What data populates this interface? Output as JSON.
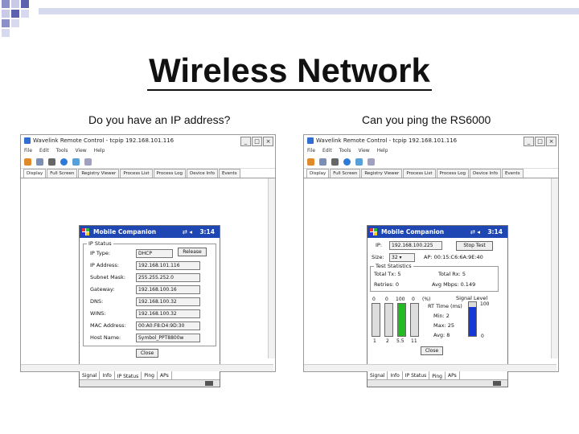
{
  "slide": {
    "title": "Wireless Network",
    "left_caption": "Do you have an IP address?",
    "right_caption": "Can you ping the RS6000"
  },
  "window_common": {
    "title": "Wavelink Remote Control - tcpip 192.168.101.116",
    "menu": [
      "File",
      "Edit",
      "Tools",
      "View",
      "Help"
    ],
    "tabs": [
      "Display",
      "Full Screen",
      "Registry Viewer",
      "Process List",
      "Process Log",
      "Device Info",
      "Events"
    ],
    "selected_tab": "Display",
    "app_name": "Mobile Companion",
    "signal_symbol": "⇄ ◂",
    "time": "3:14",
    "bottom_tabs": [
      "Signal",
      "Info",
      "IP Status",
      "Ping",
      "APs"
    ]
  },
  "left_device": {
    "selected_bottom_tab": "IP Status",
    "group_title": "IP Status",
    "release_button": "Release",
    "fields": [
      {
        "label": "IP Type:",
        "value": "DHCP"
      },
      {
        "label": "IP Address:",
        "value": "192.168.101.116"
      },
      {
        "label": "Subnet Mask:",
        "value": "255.255.252.0"
      },
      {
        "label": "Gateway:",
        "value": "192.168.100.16"
      },
      {
        "label": "DNS:",
        "value": "192.168.100.32"
      },
      {
        "label": "WINS:",
        "value": "192.168.100.32"
      },
      {
        "label": "MAC Address:",
        "value": "00:A0:F8:D4:9D:30"
      },
      {
        "label": "Host Name:",
        "value": "Symbol_PPT8800w"
      }
    ],
    "close_button": "Close"
  },
  "right_device": {
    "selected_bottom_tab": "Ping",
    "ip_label": "IP:",
    "ip_value": "192.168.100.225",
    "stop_button": "Stop Test",
    "size_label": "Size:",
    "size_value": "32",
    "ap_text": "AP: 00:15:C6:6A:9E:40",
    "stats_title": "Test Statistics",
    "total_tx": "Total Tx:   5",
    "total_rx": "Total Rx:   5",
    "retries": "Retries:   0",
    "avg_mbps": "Avg Mbps:   0.149",
    "bar_top_labels": [
      "0",
      "0",
      "100",
      "0",
      "(%)"
    ],
    "bar_bottom_labels": [
      "1",
      "2",
      "5.5",
      "11"
    ],
    "bar_fill": [
      0,
      0,
      1.0,
      0
    ],
    "rt_time_label": "RT Time (ms)",
    "min_text": "Min:   2",
    "max_text": "Max:   25",
    "avg_text": "Avg:   8",
    "signal_label": "Signal Level",
    "signal_max": "100",
    "signal_min": "0",
    "signal_fill": 0.85,
    "close_button": "Close"
  },
  "colors": {
    "device_header": "#1f47b3",
    "bar_green": "#22bb22",
    "signal_blue": "#1538d8"
  }
}
